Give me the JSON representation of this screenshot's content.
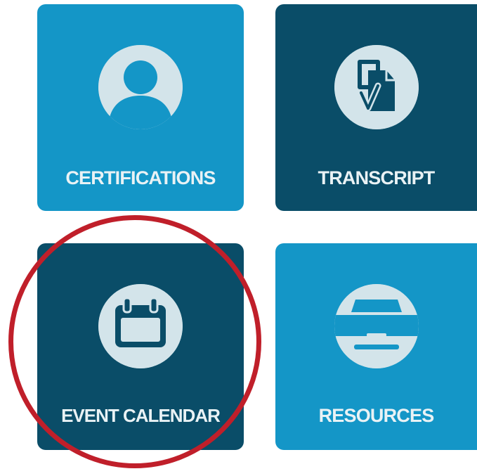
{
  "colors": {
    "light_tile": "#1496c7",
    "dark_tile": "#0a4d68",
    "icon_circle": "#d3e4ea",
    "highlight": "#c01f2a"
  },
  "tiles": [
    {
      "id": "certifications",
      "label": "CERTIFICATIONS",
      "icon": "person-icon",
      "theme": "light"
    },
    {
      "id": "transcript",
      "label": "TRANSCRIPT",
      "icon": "document-check-icon",
      "theme": "dark"
    },
    {
      "id": "event_calendar",
      "label": "EVENT CALENDAR",
      "icon": "calendar-icon",
      "theme": "dark",
      "highlighted": true
    },
    {
      "id": "resources",
      "label": "RESOURCES",
      "icon": "printer-icon",
      "theme": "light"
    }
  ]
}
